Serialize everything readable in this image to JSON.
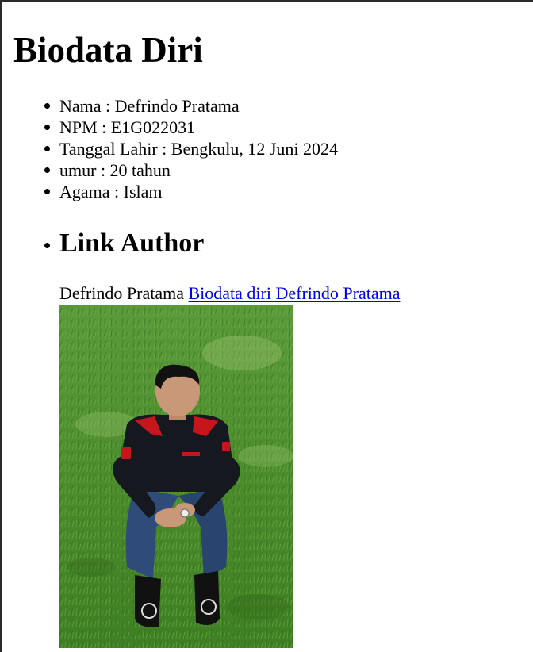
{
  "page": {
    "title": "Biodata Diri"
  },
  "biodata": {
    "items": [
      {
        "label": "Nama : Defrindo Pratama"
      },
      {
        "label": "NPM : E1G022031"
      },
      {
        "label": "Tanggal Lahir : Bengkulu, 12 Juni 2024"
      },
      {
        "label": "umur : 20 tahun"
      },
      {
        "label": "Agama : Islam"
      }
    ]
  },
  "author": {
    "heading": "Link Author",
    "name_text": "Defrindo Pratama ",
    "link_text": "Biodata diri Defrindo Pratama"
  },
  "photo": {
    "icon": "portrait-photo"
  },
  "colors": {
    "link": "#0000ee",
    "grass": "#4f8f2f",
    "shirt": "#161820",
    "shirt_accent": "#c4161c",
    "jeans": "#2f4b7a"
  }
}
